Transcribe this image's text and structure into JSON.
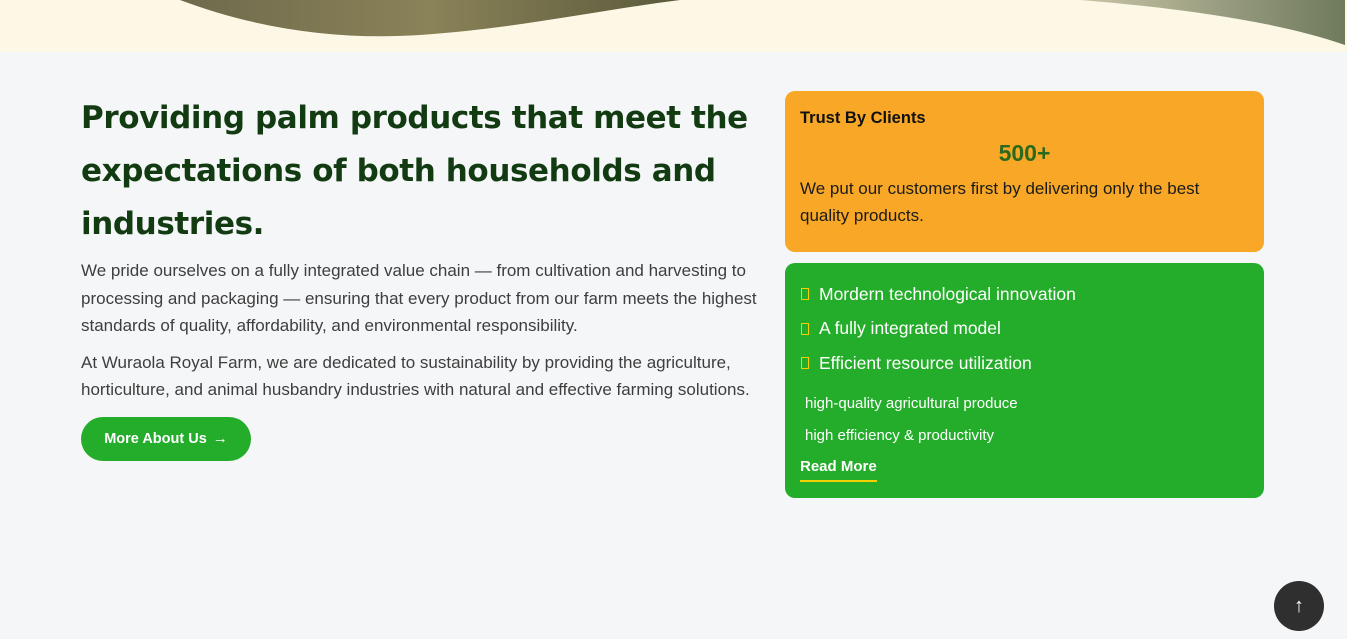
{
  "hero": {
    "headline": "Providing palm products that meet the expectations of both households and industries.",
    "paragraph_1": "We pride ourselves on a fully integrated value chain — from cultivation and harvesting to processing and packaging — ensuring that every product from our farm meets the highest standards of quality, affordability, and environmental responsibility.",
    "paragraph_2": "At Wuraola Royal Farm, we are dedicated to sustainability by providing the agriculture, horticulture, and animal husbandry industries with natural and effective farming solutions.",
    "cta_label": "More About Us",
    "cta_arrow": "→"
  },
  "trust_card": {
    "title": "Trust By Clients",
    "count": "500+",
    "description": "We put our customers first by delivering only the best quality products."
  },
  "features_card": {
    "features": [
      "Mordern technological innovation",
      "A fully integrated model",
      "Efficient resource utilization"
    ],
    "sub_items": [
      "high-quality agricultural produce",
      "high efficiency & productivity"
    ],
    "read_more": "Read More"
  },
  "scroll_top": {
    "icon": "up-arrow-icon",
    "glyph": "↑"
  },
  "colors": {
    "headline": "#123b12",
    "green": "#24ad2a",
    "orange": "#f8a826",
    "accent_yellow": "#f5d000",
    "dark_button": "#2f2f2f"
  }
}
